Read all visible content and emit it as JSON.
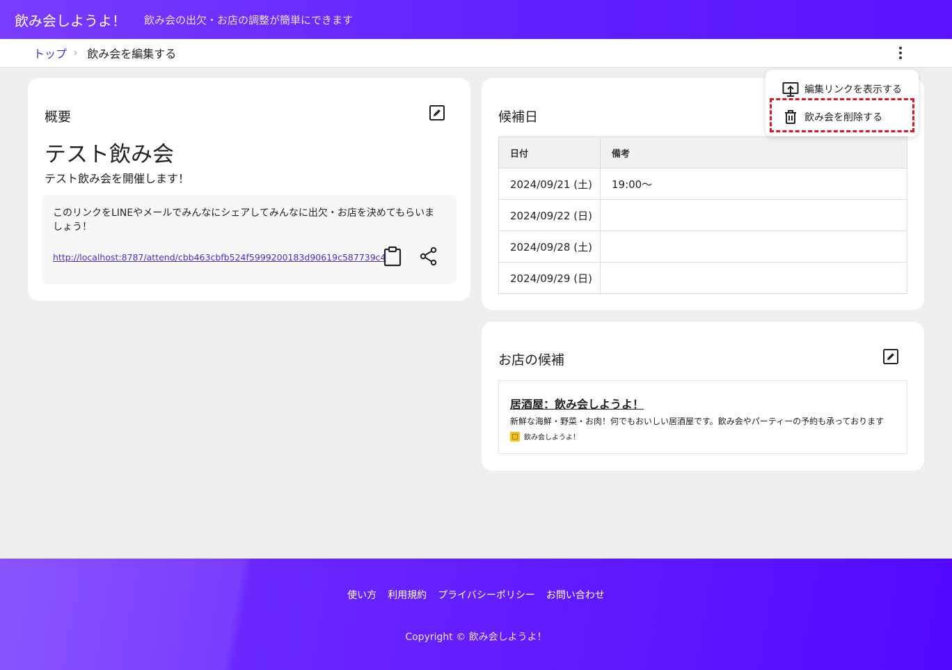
{
  "header": {
    "app_title": "飲み会しようよ！",
    "tagline": "飲み会の出欠・お店の調整が簡単にできます"
  },
  "breadcrumb": {
    "top_label": "トップ",
    "separator": "›",
    "current": "飲み会を編集する"
  },
  "overview": {
    "title": "概要",
    "event_name": "テスト飲み会",
    "event_description": "テスト飲み会を開催します！",
    "share_message": "このリンクをLINEやメールでみんなにシェアしてみんなに出欠・お店を決めてもらいましょう！",
    "share_url": "http://localhost:8787/attend/cbb463cbfb524f5999200183d90619c587739c4"
  },
  "dates": {
    "title": "候補日",
    "columns": [
      "日付",
      "備考"
    ],
    "rows": [
      {
        "date": "2024/09/21 (土)",
        "note": "19:00～"
      },
      {
        "date": "2024/09/22 (日)",
        "note": ""
      },
      {
        "date": "2024/09/28 (土)",
        "note": ""
      },
      {
        "date": "2024/09/29 (日)",
        "note": ""
      }
    ]
  },
  "shops": {
    "title": "お店の候補",
    "items": [
      {
        "name": "居酒屋：飲み会しようよ！",
        "description": "新鮮な海鮮・野菜・お肉！何でもおいしい居酒屋です。飲み会やパーティーの予約も承っております",
        "source": "飲み会しようよ！"
      }
    ]
  },
  "menu": {
    "show_edit_link": "編集リンクを表示する",
    "delete_event": "飲み会を削除する"
  },
  "footer": {
    "links": [
      "使い方",
      "利用規約",
      "プライバシーポリシー",
      "お問い合わせ"
    ],
    "copyright": "Copyright © 飲み会しようよ！"
  },
  "colors": {
    "brand": "#6322ff",
    "link": "#4b2bd9",
    "highlight": "#e0141c"
  },
  "icons": {
    "edit": "edit-icon",
    "clipboard": "clipboard-icon",
    "share": "share-icon",
    "kebab": "more-vert-icon",
    "present": "present-link-icon",
    "trash": "trash-icon"
  }
}
